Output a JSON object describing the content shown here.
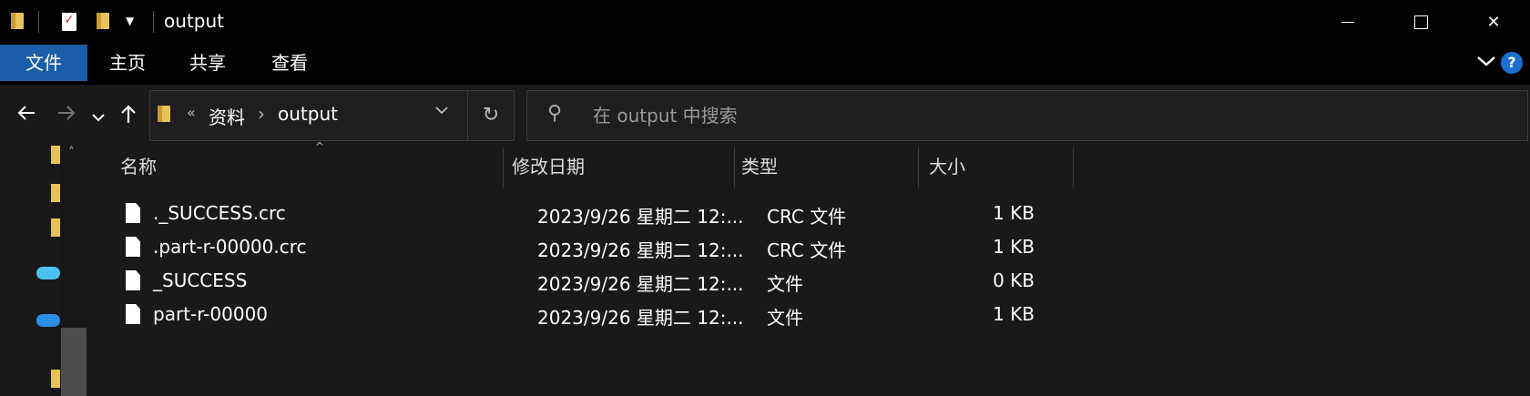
{
  "window": {
    "title": "output",
    "controls": {
      "minimize": "minimize-icon",
      "maximize": "maximize-icon",
      "close": "close-icon"
    }
  },
  "ribbon": {
    "tabs": [
      {
        "label": "文件"
      },
      {
        "label": "主页"
      },
      {
        "label": "共享"
      },
      {
        "label": "查看"
      }
    ],
    "file_tab_color": "#1a5ea8",
    "help": "?"
  },
  "address": {
    "overflow": "«",
    "crumbs": [
      "资料",
      "output"
    ],
    "separator": "›"
  },
  "search": {
    "placeholder": "在 output 中搜索"
  },
  "columns": {
    "name": "名称",
    "date": "修改日期",
    "type": "类型",
    "size": "大小"
  },
  "files": [
    {
      "name": "._SUCCESS.crc",
      "date": "2023/9/26 星期二 12:...",
      "type": "CRC 文件",
      "size": "1 KB"
    },
    {
      "name": ".part-r-00000.crc",
      "date": "2023/9/26 星期二 12:...",
      "type": "CRC 文件",
      "size": "1 KB"
    },
    {
      "name": "_SUCCESS",
      "date": "2023/9/26 星期二 12:...",
      "type": "文件",
      "size": "0 KB"
    },
    {
      "name": "part-r-00000",
      "date": "2023/9/26 星期二 12:...",
      "type": "文件",
      "size": "1 KB"
    }
  ]
}
